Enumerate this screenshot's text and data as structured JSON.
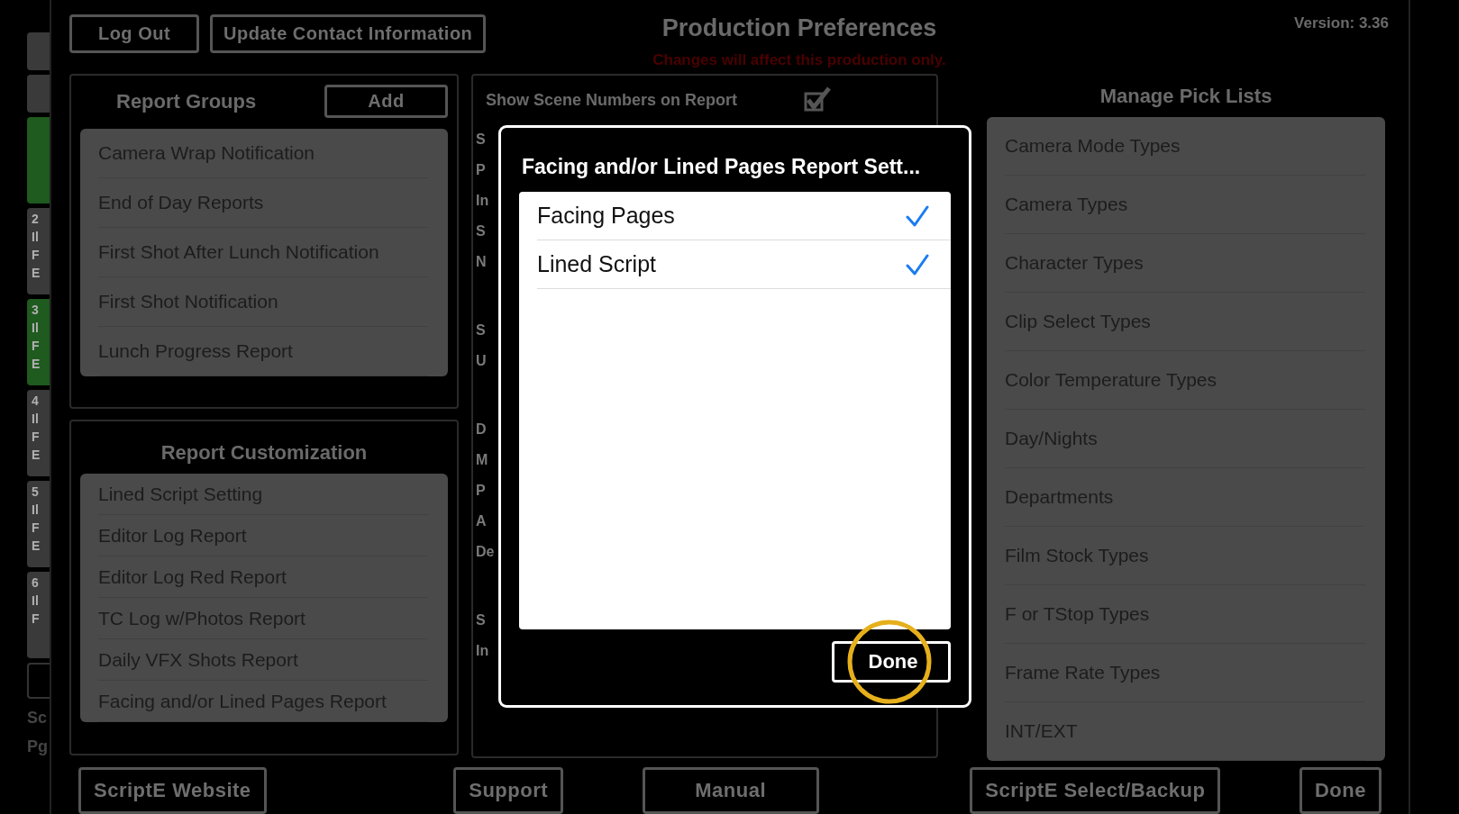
{
  "left_strip": {
    "cards": [
      {
        "color": "#3a3a3a"
      },
      {
        "color": "#3a3a3a"
      },
      {
        "color": "#1f5a1f"
      },
      {
        "color": "#3a3a3a",
        "lines": [
          "2",
          "Il",
          "F",
          "E"
        ]
      },
      {
        "color": "#1f5a1f",
        "lines": [
          "3",
          "Il",
          "F",
          "E"
        ]
      },
      {
        "color": "#3a3a3a",
        "lines": [
          "4",
          "Il",
          "F",
          "E"
        ]
      },
      {
        "color": "#3a3a3a",
        "lines": [
          "5",
          "Il",
          "F",
          "E"
        ]
      },
      {
        "color": "#3a3a3a",
        "lines": [
          "6",
          "Il",
          "F"
        ]
      }
    ],
    "footer": [
      "Sc",
      "Pg"
    ]
  },
  "header": {
    "buttons": [
      "Log Out",
      "Update Contact Information"
    ],
    "title": "Production Preferences",
    "warning": "Changes will affect this production only.",
    "version": "Version: 3.36"
  },
  "report_groups": {
    "title": "Report Groups",
    "add_button": "Add",
    "items": [
      "Camera Wrap Notification",
      "End of Day Reports",
      "First Shot After Lunch Notification",
      "First Shot Notification",
      "Lunch Progress Report"
    ]
  },
  "report_customization": {
    "title": "Report Customization",
    "items": [
      "Lined Script Setting",
      "Editor Log Report",
      "Editor Log Red Report",
      "TC Log w/Photos Report",
      "Daily VFX Shots Report",
      "Facing and/or Lined Pages Report"
    ]
  },
  "settings_panel": {
    "first_row": {
      "label": "Show Scene Numbers on Report",
      "checked": true
    },
    "groups": [
      [
        "S",
        "P",
        "In",
        "S",
        "N"
      ],
      [
        "S",
        "U"
      ],
      [
        "D",
        "M",
        "P",
        "A",
        "De"
      ],
      [
        "S",
        "In"
      ]
    ]
  },
  "pick_lists": {
    "title": "Manage Pick Lists",
    "items": [
      "Camera Mode Types",
      "Camera Types",
      "Character Types",
      "Clip Select Types",
      "Color Temperature Types",
      "Day/Nights",
      "Departments",
      "Film Stock Types",
      "F or TStop Types",
      "Frame Rate Types",
      "INT/EXT"
    ]
  },
  "footer_buttons": [
    "ScriptE Website",
    "Support",
    "Manual",
    "ScriptE Select/Backup",
    "Done"
  ],
  "dialog": {
    "title": "Facing and/or Lined Pages Report Sett...",
    "options": [
      {
        "label": "Facing Pages",
        "checked": true
      },
      {
        "label": "Lined Script",
        "checked": true
      }
    ],
    "done_button": "Done"
  }
}
